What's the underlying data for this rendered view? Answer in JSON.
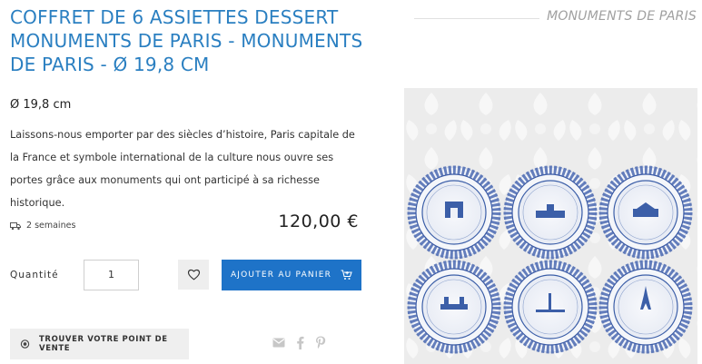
{
  "product": {
    "title": "COFFRET DE 6 ASSIETTES DESSERT MONUMENTS DE PARIS - MONUMENTS DE PARIS - Ø 19,8 CM",
    "collection": "MONUMENTS DE PARIS",
    "diameter": "Ø 19,8 cm",
    "description": "Laissons-nous emporter par des siècles d’histoire, Paris capitale de la France et symbole international de la culture nous ouvre ses portes grâce aux monuments qui ont participé à sa richesse historique.",
    "delivery": "2 semaines",
    "price": "120,00 €"
  },
  "purchase": {
    "quantity_label": "Quantité",
    "quantity_value": "1",
    "add_to_cart_label": "AJOUTER AU PANIER"
  },
  "store": {
    "find_store_label": "TROUVER VOTRE POINT DE VENTE"
  },
  "share": {
    "icons": [
      "email-icon",
      "facebook-icon",
      "pinterest-icon"
    ]
  },
  "colors": {
    "accent": "#2a7fc1",
    "button_blue": "#1e73c8",
    "plate_blue": "#3c5fa8"
  }
}
